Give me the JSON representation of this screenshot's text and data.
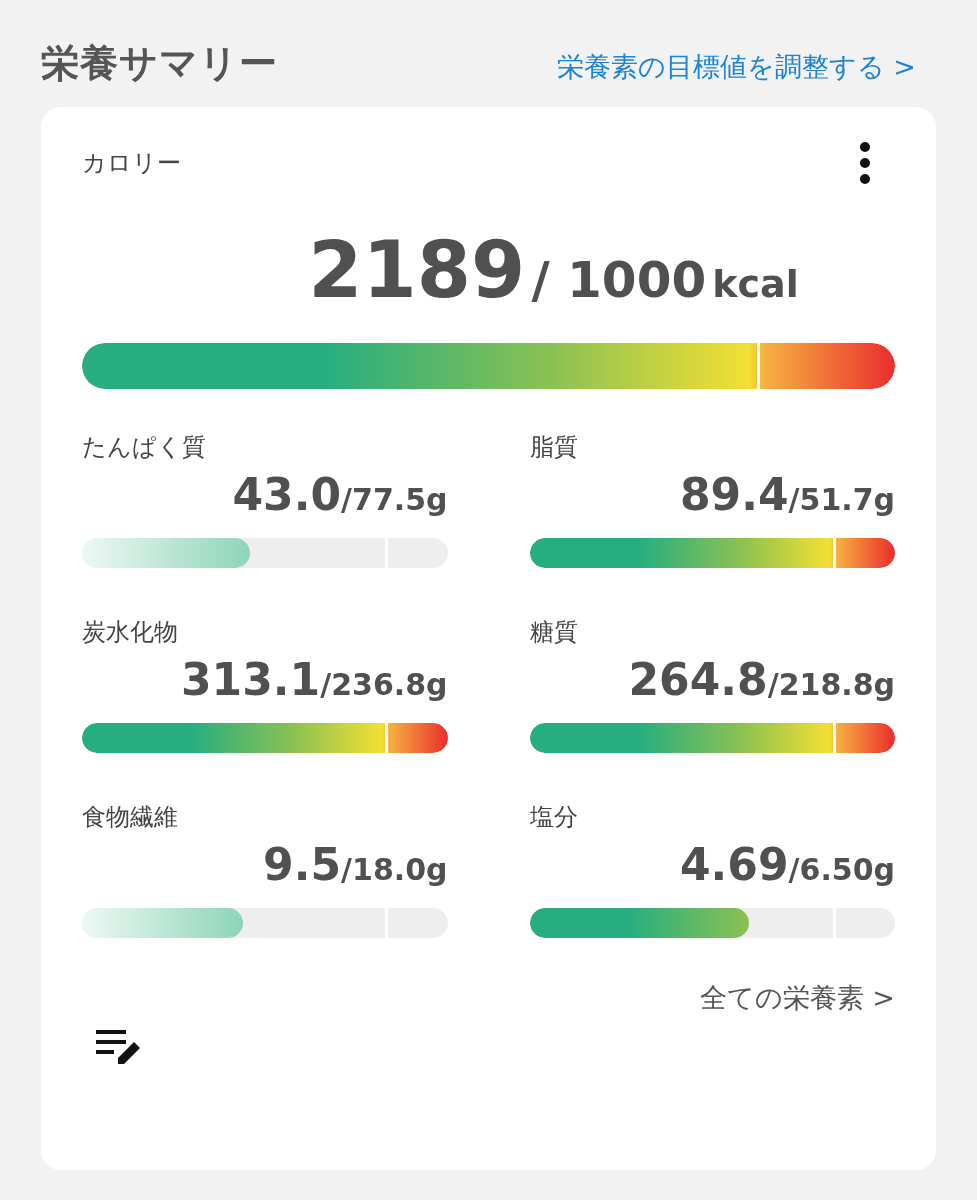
{
  "header": {
    "title": "栄養サマリー",
    "link": "栄養素の目標値を調整する >"
  },
  "calories": {
    "label": "カロリー",
    "value": "2189",
    "target": "/ 1000",
    "unit": "kcal",
    "level": 1,
    "kind": "over"
  },
  "nutrients": [
    {
      "label": "たんぱく質",
      "value": "43.0",
      "target": "/77.5g",
      "level": 0.46,
      "kind": "low"
    },
    {
      "label": "脂質",
      "value": "89.4",
      "target": "/51.7g",
      "level": 1,
      "kind": "over"
    },
    {
      "label": "炭水化物",
      "value": "313.1",
      "target": "/236.8g",
      "level": 1,
      "kind": "over"
    },
    {
      "label": "糖質",
      "value": "264.8",
      "target": "/218.8g",
      "level": 1,
      "kind": "over"
    },
    {
      "label": "食物繊維",
      "value": "9.5",
      "target": "/18.0g",
      "level": 0.44,
      "kind": "low"
    },
    {
      "label": "塩分",
      "value": "4.69",
      "target": "/6.50g",
      "level": 0.6,
      "kind": "good"
    }
  ],
  "all_link": "全ての栄養素 >"
}
